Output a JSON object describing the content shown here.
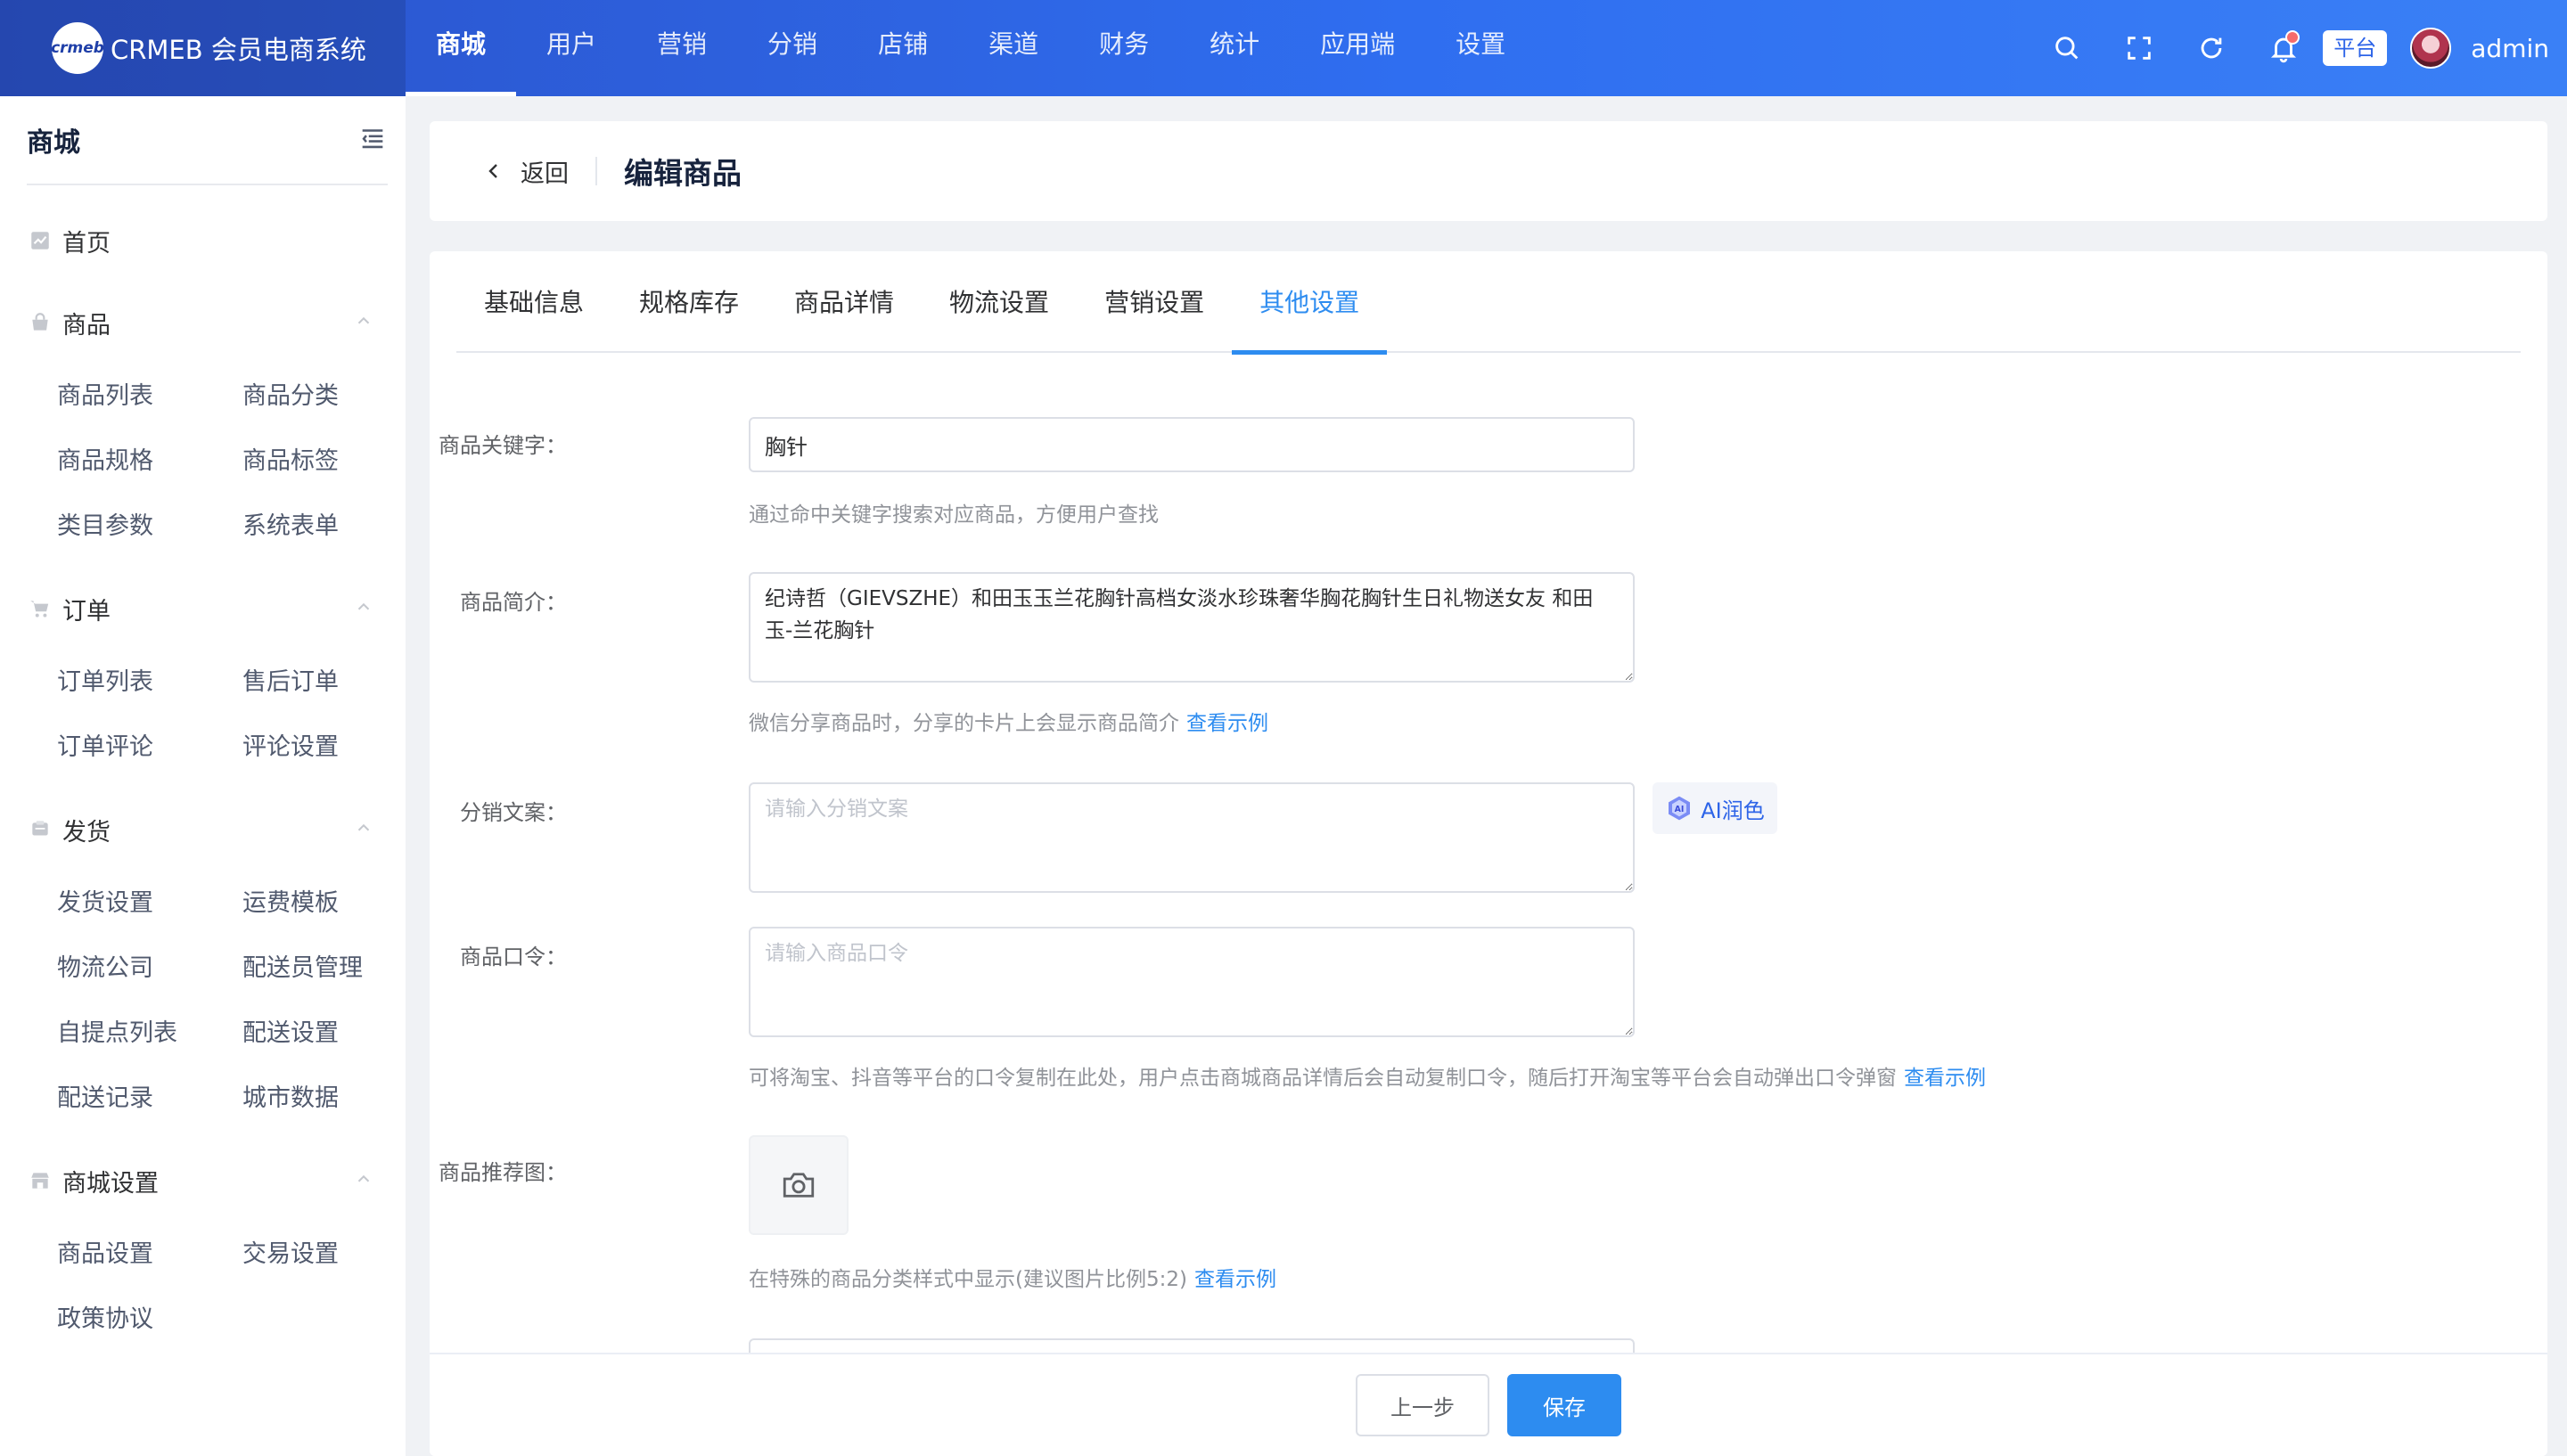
{
  "brand": {
    "logo_text": "crmeb",
    "name": "CRMEB 会员电商系统"
  },
  "topnav": {
    "items": [
      {
        "label": "商城",
        "active": true
      },
      {
        "label": "用户"
      },
      {
        "label": "营销"
      },
      {
        "label": "分销"
      },
      {
        "label": "店铺"
      },
      {
        "label": "渠道"
      },
      {
        "label": "财务"
      },
      {
        "label": "统计"
      },
      {
        "label": "应用端"
      },
      {
        "label": "设置"
      }
    ],
    "platform_badge": "平台",
    "username": "admin",
    "icons": [
      "search-icon",
      "fullscreen-icon",
      "refresh-icon",
      "bell-icon"
    ]
  },
  "sidebar": {
    "title": "商城",
    "home": "首页",
    "groups": [
      {
        "label": "商品",
        "icon": "bag-icon",
        "items": [
          "商品列表",
          "商品分类",
          "商品规格",
          "商品标签",
          "类目参数",
          "系统表单"
        ]
      },
      {
        "label": "订单",
        "icon": "cart-icon",
        "items": [
          "订单列表",
          "售后订单",
          "订单评论",
          "评论设置"
        ]
      },
      {
        "label": "发货",
        "icon": "truck-icon",
        "items": [
          "发货设置",
          "运费模板",
          "物流公司",
          "配送员管理",
          "自提点列表",
          "配送设置",
          "配送记录",
          "城市数据"
        ]
      },
      {
        "label": "商城设置",
        "icon": "store-icon",
        "items": [
          "商品设置",
          "交易设置",
          "政策协议"
        ]
      }
    ]
  },
  "header": {
    "back_label": "返回",
    "title": "编辑商品"
  },
  "tabs": [
    {
      "label": "基础信息"
    },
    {
      "label": "规格库存"
    },
    {
      "label": "商品详情"
    },
    {
      "label": "物流设置"
    },
    {
      "label": "营销设置"
    },
    {
      "label": "其他设置",
      "active": true
    }
  ],
  "form": {
    "keyword": {
      "label": "商品关键字：",
      "value": "胸针",
      "hint": "通过命中关键字搜索对应商品，方便用户查找"
    },
    "intro": {
      "label": "商品简介：",
      "value": "纪诗哲（GIEVSZHE）和田玉玉兰花胸针高档女淡水珍珠奢华胸花胸针生日礼物送女友 和田玉-兰花胸针",
      "hint": "微信分享商品时，分享的卡片上会显示商品简介",
      "hint_link": "查看示例"
    },
    "distribution_copy": {
      "label": "分销文案：",
      "placeholder": "请输入分销文案",
      "ai_label": "AI润色"
    },
    "command": {
      "label": "商品口令：",
      "placeholder": "请输入商品口令",
      "hint": "可将淘宝、抖音等平台的口令复制在此处，用户点击商城商品详情后会自动复制口令，随后打开淘宝等平台会自动弹出口令弹窗",
      "hint_link": "查看示例"
    },
    "recommend_image": {
      "label": "商品推荐图：",
      "hint": "在特殊的商品分类样式中显示(建议图片比例5:2)",
      "hint_link": "查看示例"
    }
  },
  "footer": {
    "prev_label": "上一步",
    "save_label": "保存"
  }
}
